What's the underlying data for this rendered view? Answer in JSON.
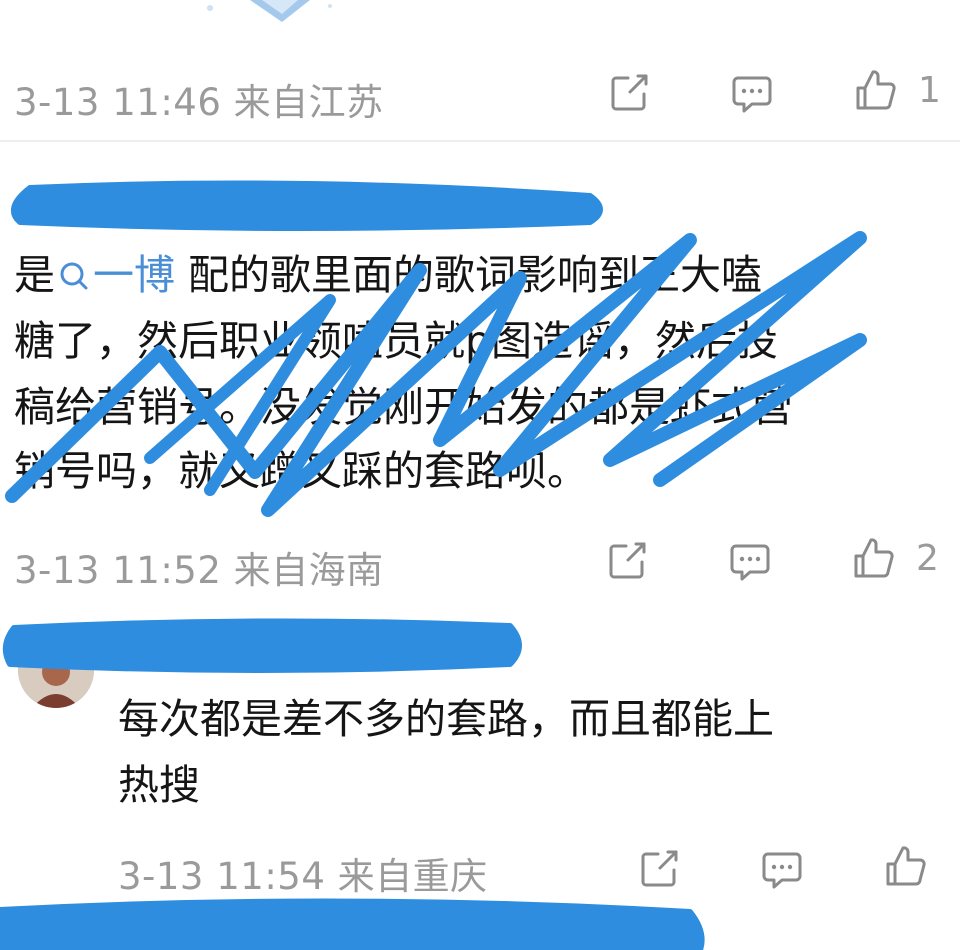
{
  "comments": [
    {
      "meta": "3-13 11:46 来自江苏",
      "like_count": "1"
    },
    {
      "tag_label": "一博",
      "lines": [
        "配的歌里面的歌词影响到王大嗑",
        "糖了，然后职业领嗑员就p图造谣，然后投",
        "稿给营销号。没发觉刚开始发的都是虾式营",
        "销号吗，就又蹭又踩的套路呗。"
      ],
      "line1_prefix": "是",
      "meta": "3-13 11:52 来自海南",
      "like_count": "2"
    },
    {
      "lines": [
        "每次都是差不多的套路，而且都能上",
        "热搜"
      ],
      "meta": "3-13 11:54 来自重庆",
      "like_count": ""
    }
  ],
  "icons": {
    "share": "share-icon",
    "comment": "comment-icon",
    "like": "thumbs-up-icon",
    "search": "search-icon"
  },
  "colors": {
    "scribble": "#2e8ddf",
    "meta_text": "#9a9a9a",
    "tag": "#4a8fd6"
  }
}
